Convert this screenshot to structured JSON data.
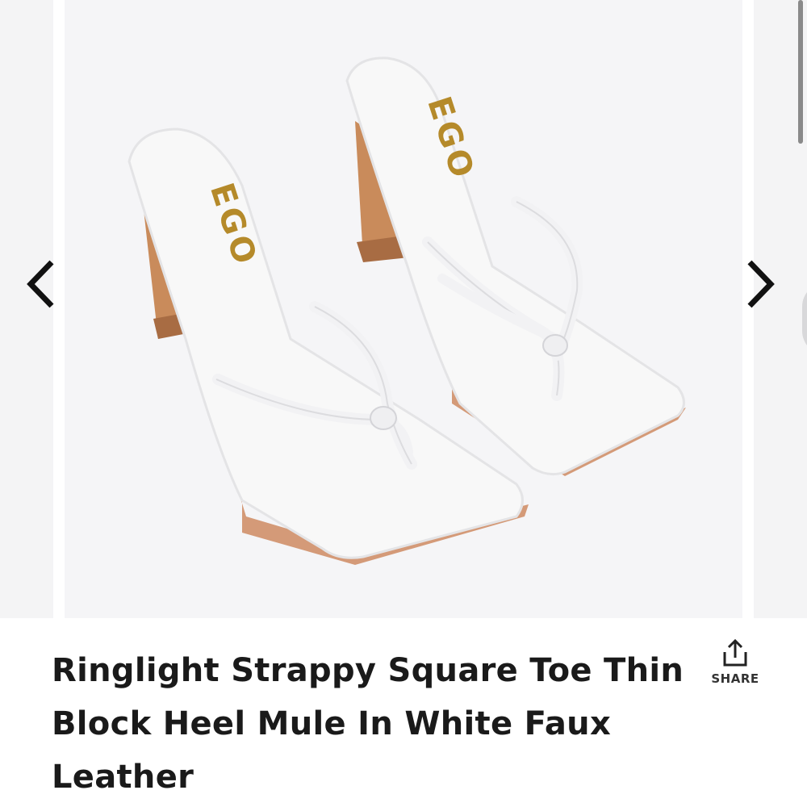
{
  "product": {
    "title": "Ringlight Strappy Square Toe Thin Block Heel Mule In White Faux Leather",
    "insole_brand": "EGO"
  },
  "actions": {
    "share_label": "SHARE"
  },
  "icons": {
    "prev": "chevron-left-icon",
    "next": "chevron-right-icon",
    "share": "share-upload-icon"
  },
  "colors": {
    "shoe": "#f7f7f7",
    "heel": "#c88a5c",
    "logo": "#b58a2a",
    "text": "#1a1a1a",
    "background": "#f5f5f7"
  }
}
